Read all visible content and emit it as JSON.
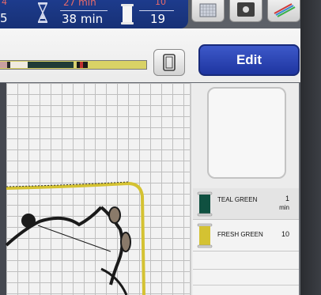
{
  "status_bar": {
    "stitch_count_partial": "5",
    "stitch_count_top_partial": "4",
    "time_total": "38 min",
    "time_remaining_partial": "27 min",
    "color_total": "19",
    "color_current_partial": "10"
  },
  "toolbar": {
    "edit_label": "Edit"
  },
  "threads": [
    {
      "name": "TEAL GREEN",
      "value": "1",
      "unit": "min",
      "color": "#0f5040"
    },
    {
      "name": "FRESH GREEN",
      "value": "10",
      "unit": "",
      "color": "#d4c232"
    }
  ],
  "colors": {
    "status_bar_bg": "#1d3b8c",
    "edit_button_bg": "#2a44b5",
    "design_outline": "#d4c232",
    "design_stroke": "#1a1a1a"
  },
  "icons": [
    "hourglass-icon",
    "thread-spool-icon",
    "pattern-grid-icon",
    "color-picker-icon",
    "color-spectrum-icon",
    "embroidery-frame-icon"
  ]
}
